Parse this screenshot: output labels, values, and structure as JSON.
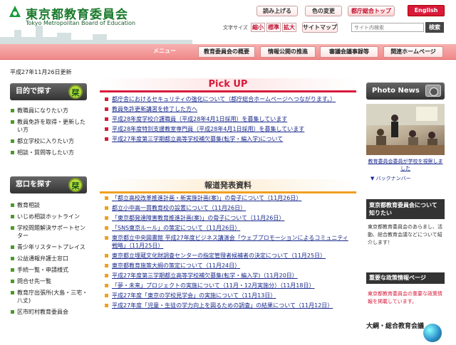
{
  "header": {
    "title": "東京都教育委員会",
    "subtitle": "Tokyo Metropolitan Board of Education",
    "read_aloud": "読み上げる",
    "color_change": "色の変更",
    "metro_top": "都庁総合トップ",
    "english": "English",
    "font_size_label": "文字サイズ",
    "font_small": "縮小",
    "font_standard": "標準",
    "font_large": "拡大",
    "sitemap": "サイトマップ",
    "search_placeholder": "サイト内検索",
    "search_button": "検索"
  },
  "nav": {
    "menu": "メニュー",
    "items": [
      "教育委員会の概要",
      "情報公開の推進",
      "審議会議事録等",
      "関連ホームページ"
    ]
  },
  "updated": "平成27年11月26日更新",
  "left": {
    "purpose_title": "目的で探す",
    "purpose_badge": "栞",
    "purpose_items": [
      "教職員になりたい方",
      "教員免許を取得・更新したい方",
      "都立学校に入りたい方",
      "相談・質問等したい方"
    ],
    "window_title": "窓口を探す",
    "window_badge": "栞",
    "window_items": [
      "教育相談",
      "いじめ相談ホットライン",
      "学校問題解決サポートセンター",
      "青少年リスタートプレイス",
      "公益通報弁護士窓口",
      "手続一覧・申請様式",
      "問合せ先一覧",
      "教育庁出張所(大島・三宅・八丈)",
      "区市町村教育委員会"
    ]
  },
  "pickup": {
    "title": "Pick UP",
    "items": [
      "都庁舎におけるセキュリティの強化について（都庁総合ホームページへつながります。）",
      "教員免許更新講習を修了した方へ",
      "平成28年度学校介護職員（平成28年4月1日採用）を募集しています",
      "平成28年度特別支援教室専門員（平成28年4月1日採用）を募集しています",
      "平成27年度第三学期都立高等学校補欠募集(転学・編入学)について"
    ]
  },
  "press": {
    "title": "報道発表資料",
    "items": [
      "「都立高校改革推進計画・新実施計画(案)」の骨子について（11月26日）",
      "都立小中高一貫教育校の設置について（11月26日）",
      "「東京都発達障害教育推進計画(案)」の骨子について（11月26日）",
      "「SNS東京ルール」の策定について（11月26日）",
      "東京都立中央図書館 平成27年度ビジネス講演会「ウェブプロモーションによるコミュニティ戦略」（11月25日）",
      "東京都立埋蔵文化財調査センターの指定管理者候補者の決定について（11月25日）",
      "東京都教育施策大綱の策定について（11月24日）",
      "平成27年度第三学期都立高等学校補欠募集(転学・編入学)（11月20日）",
      "「夢・未来」プロジェクトの実施について（11月・12月実施分）（11月18日）",
      "平成27年度「東京の学校見学会」の実施について（11月13日）",
      "平成27年度「児童・生徒の学力向上を図るための調査」の結果について（11月12日）"
    ]
  },
  "right": {
    "photo_news": "Photo News",
    "photo_caption": "教育委員会委員が学校を視察しました",
    "back_number": "▼ バックナンバー",
    "know_title": "東京都教育委員会について知りたい",
    "know_text": "東京都教育委員会のあらまし、活動、総合教育会議などについて紹介します！",
    "policy_title": "重要な政策情報ページ",
    "policy_text": "東京都教育委員会の重要な政策情報を掲載しています。",
    "taiko": "大綱・総合教育会議"
  }
}
